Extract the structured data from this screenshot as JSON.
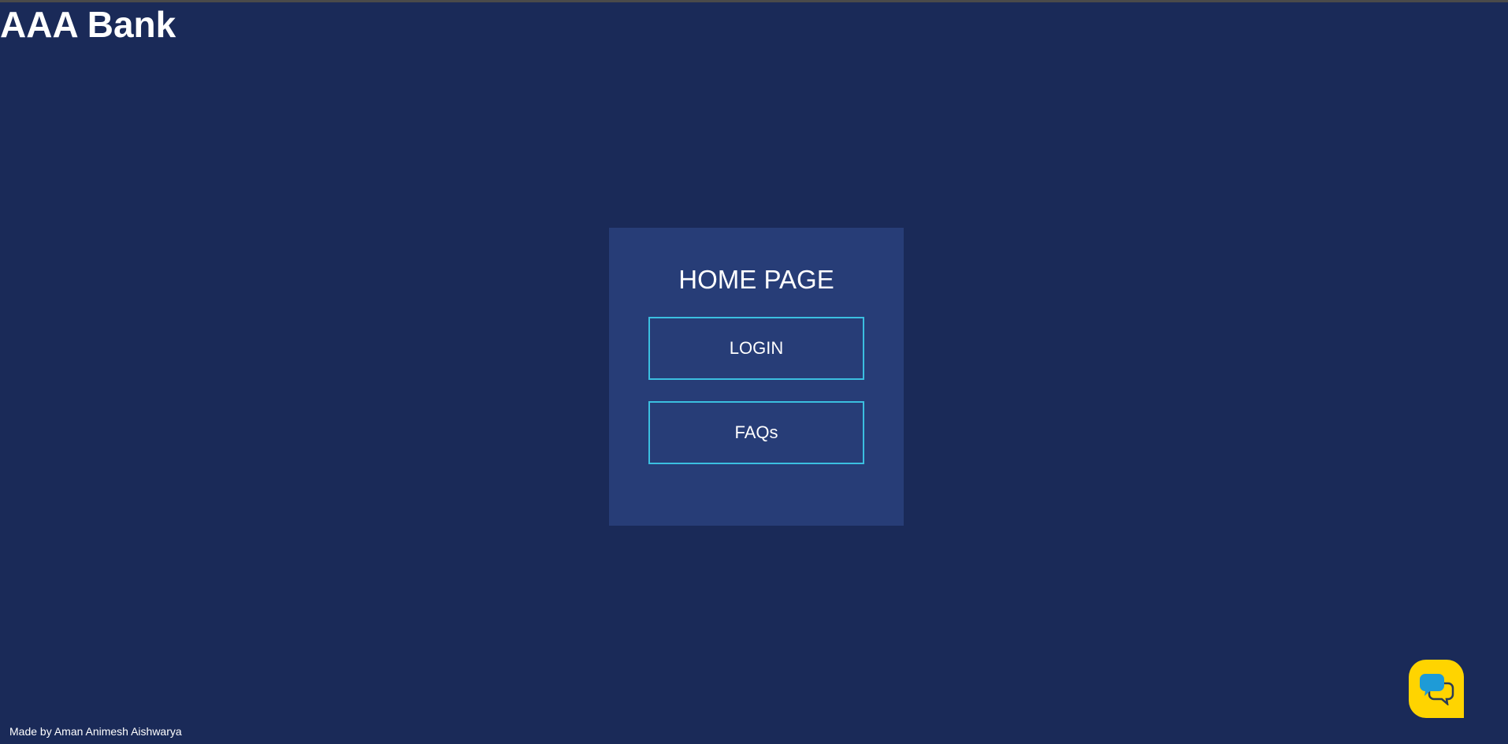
{
  "header": {
    "brand": "AAA Bank"
  },
  "home": {
    "title": "HOME PAGE",
    "buttons": [
      {
        "label": "LOGIN"
      },
      {
        "label": "FAQs"
      }
    ]
  },
  "footer": {
    "credit": "Made by Aman Animesh Aishwarya"
  },
  "chat_widget": {
    "icon": "chat-bubbles-icon"
  },
  "colors": {
    "background": "#1a2a58",
    "card": "#273d77",
    "button_border": "#3bbfe0",
    "chat_fab": "#ffd400",
    "chat_bubble_front": "#1e9bd7",
    "chat_bubble_back": "#2a3b55"
  }
}
